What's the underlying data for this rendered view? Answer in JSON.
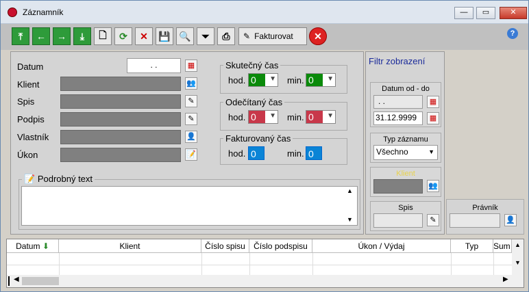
{
  "window": {
    "title": "Záznamník"
  },
  "toolbar": {
    "fakturovat_label": "Fakturovat"
  },
  "form": {
    "labels": [
      "Datum",
      "Klient",
      "Spis",
      "Podpis",
      "Vlastník",
      "Úkon"
    ],
    "datum_value": ". .",
    "podrobny_text_label": "Podrobný text"
  },
  "times": {
    "skutecny": {
      "title": "Skutečný čas",
      "hod_label": "hod.",
      "min_label": "min.",
      "hod": "0",
      "min": "0"
    },
    "odecitany": {
      "title": "Odečítaný čas",
      "hod_label": "hod.",
      "min_label": "min.",
      "hod": "0",
      "min": "0"
    },
    "fakturovany": {
      "title": "Fakturovaný čas",
      "hod_label": "hod.",
      "min_label": "min.",
      "hod": "0",
      "min": "0"
    }
  },
  "filter": {
    "title": "Filtr zobrazení",
    "datum_label": "Datum od - do",
    "datum_od": ". .",
    "datum_do": "31.12.9999",
    "typ_label": "Typ záznamu",
    "typ_value": "Všechno",
    "klient_label": "Klient",
    "spis_label": "Spis",
    "pravnik_label": "Právník"
  },
  "grid": {
    "columns": [
      "Datum",
      "Klient",
      "Číslo spisu",
      "Číslo podspisu",
      "Úkon / Výdaj",
      "Typ",
      "Sum"
    ]
  }
}
